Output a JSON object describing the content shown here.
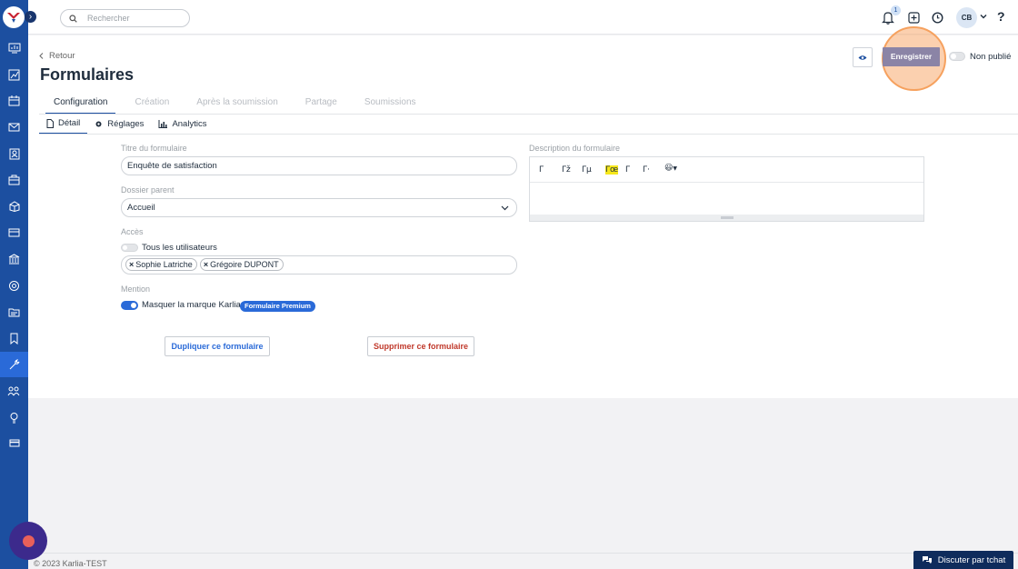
{
  "topbar": {
    "search_placeholder": "Rechercher",
    "notification_count": "1",
    "user_initials": "CB",
    "help_label": "?"
  },
  "header": {
    "back_label": "Retour",
    "title": "Formulaires",
    "save_label": "Enregistrer",
    "publish_status": "Non publié"
  },
  "tabs": [
    "Configuration",
    "Création",
    "Après la soumission",
    "Partage",
    "Soumissions"
  ],
  "subtabs": [
    {
      "label": "Détail",
      "icon": "document-icon"
    },
    {
      "label": "Réglages",
      "icon": "gear-icon"
    },
    {
      "label": "Analytics",
      "icon": "bar-chart-icon"
    }
  ],
  "form": {
    "title_label": "Titre du formulaire",
    "title_value": "Enquête de satisfaction",
    "folder_label": "Dossier parent",
    "folder_value": "Accueil",
    "access_label": "Accès",
    "all_users_label": "Tous les utilisateurs",
    "users": [
      "Sophie Latriche",
      "Grégoire DUPONT"
    ],
    "mention_label": "Mention",
    "hide_brand_label": "Masquer la marque Karlia",
    "premium_badge": "Formulaire Premium",
    "description_label": "Description du formulaire",
    "duplicate_label": "Dupliquer ce formulaire",
    "delete_label": "Supprimer ce formulaire"
  },
  "editor_tools": [
    "Γ",
    "Γž",
    "Γμ",
    "Γœ",
    "Γ",
    "Γ·",
    "😃"
  ],
  "footer": {
    "copyright": "© 2023 Karlia-TEST",
    "chat_label": "Discuter par tchat"
  },
  "colors": {
    "sidebar": "#1c4fa0",
    "accent": "#2a6ad8",
    "save_button": "#8b84a6",
    "delete": "#c0392b",
    "highlight_halo": "#f6a15e"
  }
}
